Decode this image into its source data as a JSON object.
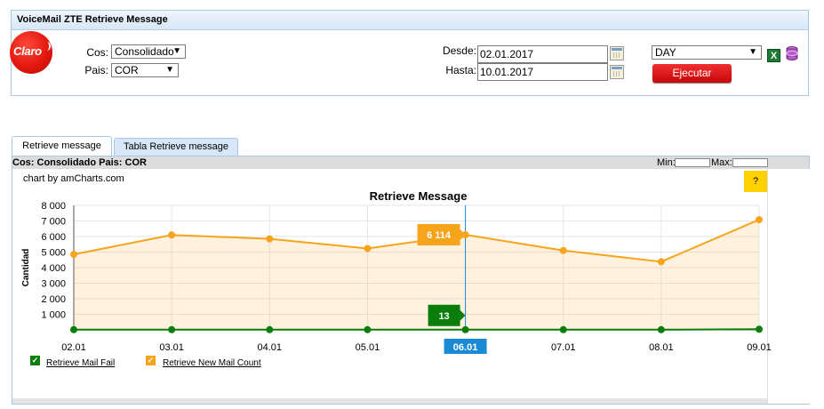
{
  "window": {
    "title": "VoiceMail ZTE Retrieve Message"
  },
  "logo": {
    "text": "Claro"
  },
  "filters": {
    "cos_label": "Cos:",
    "cos_value": "Consolidado",
    "pais_label": "Pais:",
    "pais_value": "COR",
    "desde_label": "Desde:",
    "desde_value": "02.01.2017",
    "hasta_label": "Hasta:",
    "hasta_value": "10.01.2017",
    "period_value": "DAY",
    "execute_label": "Ejecutar"
  },
  "tabs": [
    {
      "label": "Retrieve message",
      "active": true
    },
    {
      "label": "Tabla Retrieve message",
      "active": false
    }
  ],
  "chart_panel": {
    "info_text": "Cos: Consolidado Pais: COR",
    "min_label": "Min:",
    "max_label": "Max:",
    "credit": "chart by amCharts.com",
    "help_label": "?"
  },
  "colors": {
    "accent": "#1a8ad4",
    "orange": "#f7a41d",
    "green": "#0a7d0a",
    "execute": "#dd1111"
  },
  "chart_data": {
    "type": "line",
    "title": "Retrieve Message",
    "ylabel": "Cantidad",
    "xlabel": "",
    "categories": [
      "02.01",
      "03.01",
      "04.01",
      "05.01",
      "06.01",
      "07.01",
      "08.01",
      "09.01"
    ],
    "ylim": [
      0,
      8000
    ],
    "yticks": [
      1000,
      2000,
      3000,
      4000,
      5000,
      6000,
      7000,
      8000
    ],
    "ytick_labels": [
      "1 000",
      "2 000",
      "3 000",
      "4 000",
      "5 000",
      "6 000",
      "7 000",
      "8 000"
    ],
    "grid": true,
    "legend_position": "bottom-left",
    "cursor_category": "06.01",
    "series": [
      {
        "name": "Retrieve Mail Fail",
        "color": "#0a7d0a",
        "values": [
          12,
          14,
          13,
          12,
          13,
          12,
          11,
          40
        ]
      },
      {
        "name": "Retrieve New Mail Count",
        "color": "#f7a41d",
        "values": [
          4850,
          6100,
          5850,
          5230,
          6114,
          5100,
          4380,
          7080
        ]
      }
    ],
    "balloons": [
      {
        "series": 1,
        "text": "6 114"
      },
      {
        "series": 0,
        "text": "13"
      }
    ]
  }
}
